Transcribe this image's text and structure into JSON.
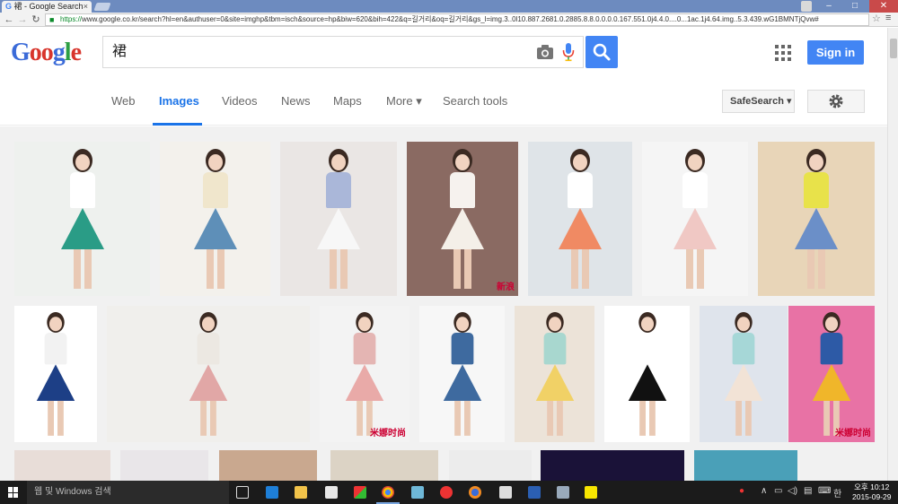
{
  "browser": {
    "tab_title": "裙 - Google Search",
    "tab_close": "×",
    "url_scheme": "https://",
    "url_rest": "www.google.co.kr/search?hl=en&authuser=0&site=imghp&tbm=isch&source=hp&biw=620&bih=422&q=길거리&oq=길거리&gs_l=img.3..0l10.887.2681.0.2885.8.8.0.0.0.0.167.551.0j4.4.0....0...1ac.1j4.64.img..5.3.439.wG1BMNTjQvw#"
  },
  "google": {
    "logo_letters": [
      {
        "ch": "G",
        "color": "#3b6bd8"
      },
      {
        "ch": "o",
        "color": "#d8352c"
      },
      {
        "ch": "o",
        "color": "#d8352c"
      },
      {
        "ch": "g",
        "color": "#3b6bd8"
      },
      {
        "ch": "l",
        "color": "#2d9f44"
      },
      {
        "ch": "e",
        "color": "#d8352c"
      }
    ],
    "query": "裙",
    "signin_label": "Sign in"
  },
  "nav": {
    "tabs": [
      {
        "label": "Web",
        "active": false
      },
      {
        "label": "Images",
        "active": true
      },
      {
        "label": "Videos",
        "active": false
      },
      {
        "label": "News",
        "active": false
      },
      {
        "label": "Maps",
        "active": false
      },
      {
        "label": "More ▾",
        "active": false
      },
      {
        "label": "Search tools",
        "active": false
      }
    ],
    "safesearch_label": "SafeSearch ▾"
  },
  "results": [
    {
      "bg": "#eef1ee",
      "top": "#ffffff",
      "skirt": "#2a9c86",
      "watermark": ""
    },
    {
      "bg": "#f3f1ec",
      "top": "#f0e6cc",
      "skirt": "#5e8fb8",
      "watermark": ""
    },
    {
      "bg": "#eae6e4",
      "top": "#aab7d9",
      "skirt": "#f7f7f7",
      "watermark": ""
    },
    {
      "bg": "#8a6a62",
      "top": "#f6f2ee",
      "skirt": "#f4efe8",
      "watermark": "新浪"
    },
    {
      "bg": "#dfe4e8",
      "top": "#ffffff",
      "skirt": "#f08a63",
      "watermark": ""
    },
    {
      "bg": "#f5f5f5",
      "top": "#ffffff",
      "skirt": "#f0c8c4",
      "watermark": ""
    },
    {
      "bg": "#e8d5b8",
      "top": "#e8e24a",
      "skirt": "#6b8fc8",
      "watermark": ""
    },
    {
      "bg": "#ffffff",
      "top": "#f2f2f2",
      "skirt": "#1d3f86",
      "watermark": ""
    },
    {
      "bg": "#f0efec",
      "top": "#ece8e2",
      "skirt": "#e1a7a6",
      "watermark": ""
    },
    {
      "bg": "#f3f3f3",
      "top": "#e4b5b3",
      "skirt": "#e9aaa8",
      "watermark": "米娜时尚"
    },
    {
      "bg": "#f7f7f7",
      "top": "#3e6a9f",
      "skirt": "#3e6a9f",
      "watermark": ""
    },
    {
      "bg": "#ece3d8",
      "top": "#a8d7cf",
      "skirt": "#f1d166",
      "watermark": ""
    },
    {
      "bg": "#ffffff",
      "top": "#ffffff",
      "skirt": "#111111",
      "watermark": ""
    },
    {
      "bg": "#dfe4ec",
      "top": "#a6d7d7",
      "skirt": "#f2e3d6",
      "watermark": ""
    },
    {
      "bg": "#e872a5",
      "top": "#2d5aa6",
      "skirt": "#f0b62a",
      "watermark": "米娜时尚"
    }
  ],
  "taskbar": {
    "search_placeholder": "웹 및 Windows 검색",
    "clock_time": "오후 10:12",
    "clock_date": "2015-09-29"
  }
}
